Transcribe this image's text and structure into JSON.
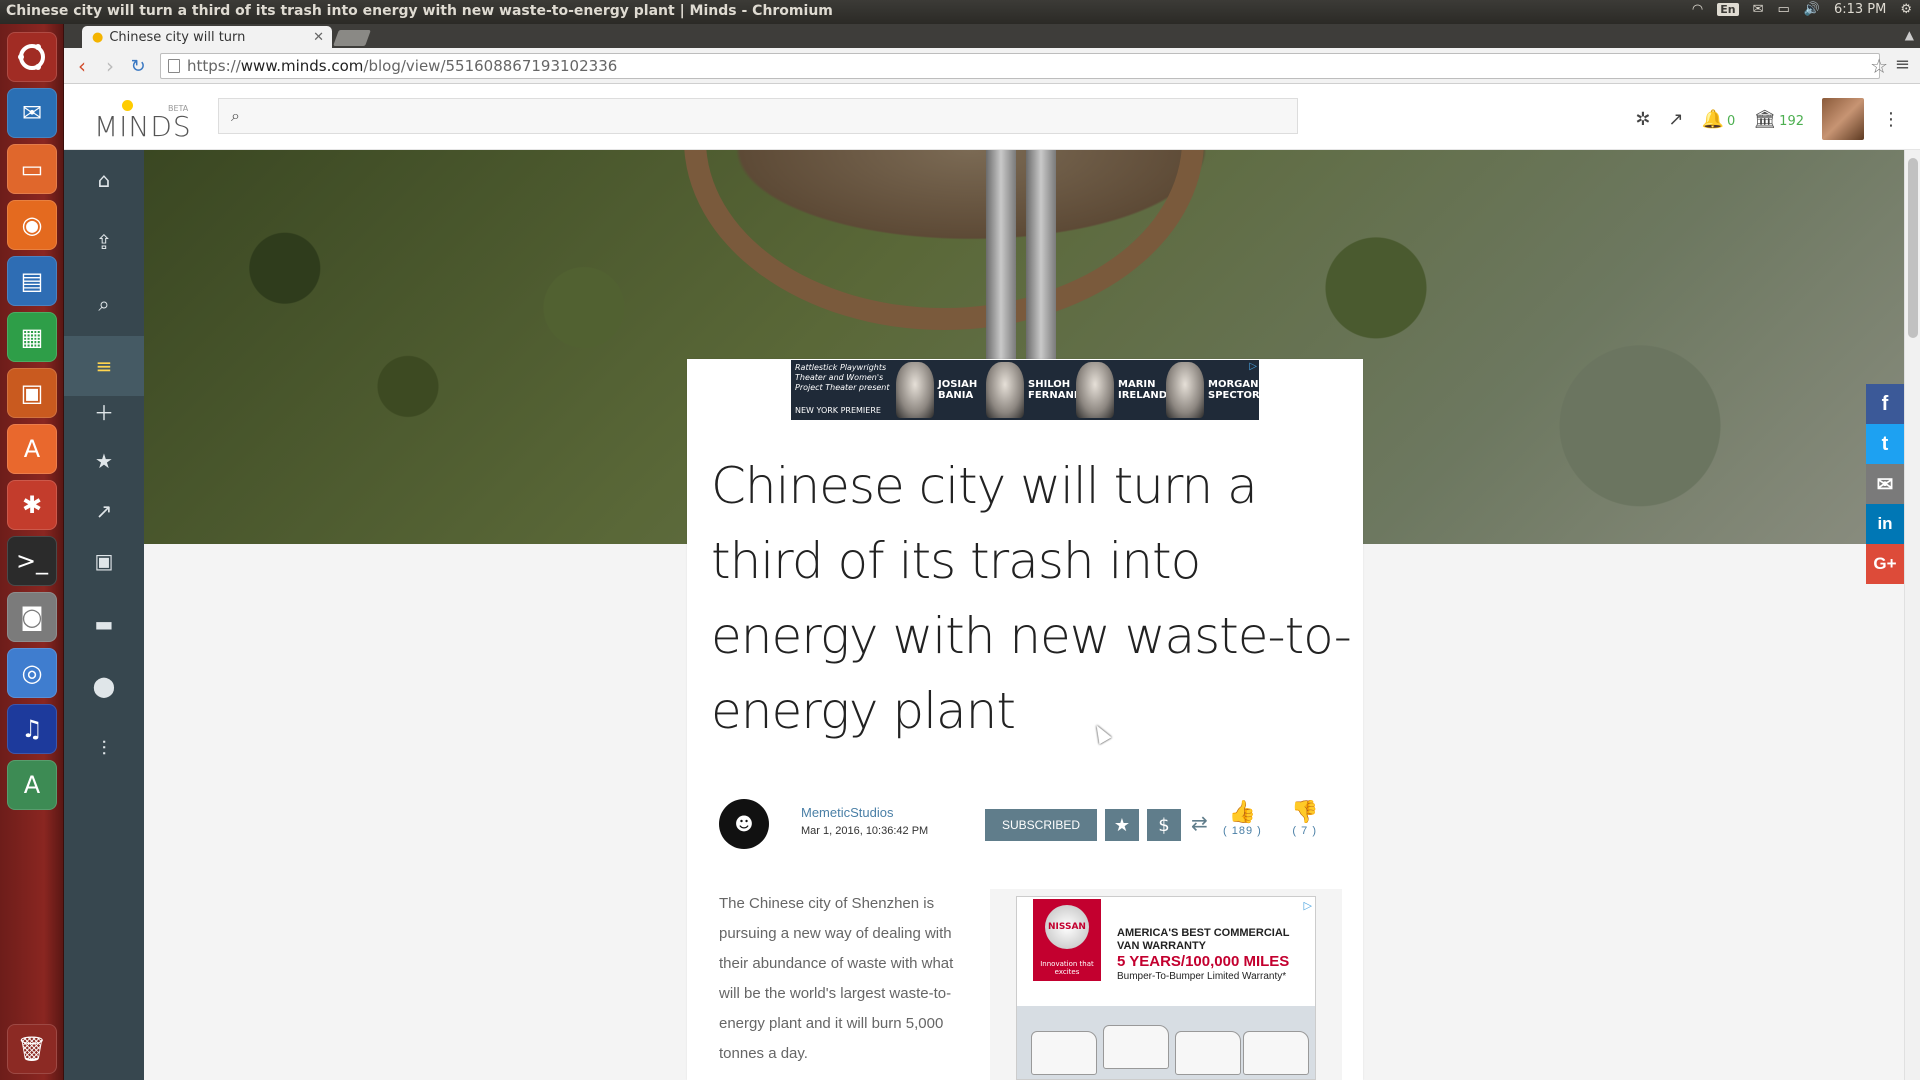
{
  "os": {
    "window_title": "Chinese city will turn a third of its trash into energy with new waste-to-energy plant | Minds - Chromium",
    "keyboard_layout": "En",
    "clock": "6:13 PM",
    "launcher_items": [
      "ubuntu-logo",
      "thunderbird",
      "files",
      "firefox",
      "libreoffice-writer",
      "libreoffice-calc",
      "libreoffice-impress",
      "software-center",
      "system-settings",
      "terminal",
      "camera",
      "chromium",
      "audacity",
      "software-updater",
      "trash"
    ]
  },
  "browser": {
    "tab_title": "Chinese city will turn",
    "url_scheme": "https://",
    "url_host": "www.minds.com",
    "url_path": "/blog/view/551608867193102336"
  },
  "minds": {
    "logo_text": "MINDS",
    "logo_beta": "BETA",
    "search_placeholder": "",
    "notifications_count": "0",
    "wallet_count": "192",
    "accent_color": "#ffd54f",
    "sidebar_items": [
      "home",
      "upload",
      "search",
      "blogs",
      "create",
      "featured",
      "trending",
      "groups",
      "messenger",
      "channels",
      "settings"
    ]
  },
  "ad_top": {
    "presenter": "Rattlestick Playwrights Theater and Women's Project Theater present",
    "tagline": "NEW YORK PREMIERE",
    "actors": [
      "JOSIAH BANIA",
      "SHILOH FERNANDEZ",
      "MARIN IRELAND",
      "MORGAN SPECTOR"
    ]
  },
  "article": {
    "headline": "Chinese city will turn a third of its trash into energy with new waste-to-energy plant",
    "author": "MemeticStudios",
    "date": "Mar 1, 2016, 10:36:42 PM",
    "subscribe_label": "SUBSCRIBED",
    "thumbs_up_count": "( 189 )",
    "thumbs_down_count": "( 7 )",
    "body": "The Chinese city of Shenzhen is pursuing a new way of dealing with their abundance of waste with what will be the world's largest waste-to-energy plant and it will burn 5,000 tonnes a day."
  },
  "ad_side": {
    "brand": "NISSAN",
    "brand_tag": "Innovation that excites",
    "line1": "AMERICA'S BEST COMMERCIAL VAN WARRANTY",
    "line2": "5 YEARS/100,000 MILES",
    "line3": "Bumper-To-Bumper Limited Warranty*"
  },
  "share": {
    "facebook": "f",
    "twitter": "t",
    "email": "✉",
    "linkedin": "in",
    "googleplus": "G+"
  }
}
